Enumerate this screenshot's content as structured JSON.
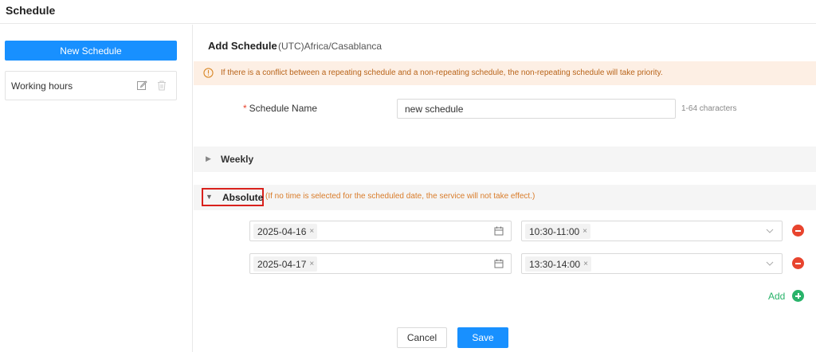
{
  "page": {
    "title": "Schedule"
  },
  "sidebar": {
    "new_button": "New Schedule",
    "schedules": [
      {
        "name": "Working hours",
        "icons": [
          "edit-icon",
          "delete-icon"
        ]
      }
    ]
  },
  "form": {
    "title": "Add Schedule",
    "timezone": "(UTC)Africa/Casablanca",
    "warning": "If there is a conflict between a repeating schedule and a non-repeating schedule, the non-repeating schedule will take priority.",
    "name_label": "Schedule Name",
    "required_mark": "*",
    "name_value": "new schedule",
    "name_hint": "1-64 characters",
    "weekly_label": "Weekly",
    "absolute_label": "Absolute",
    "absolute_note": "(If no time is selected for the scheduled date, the service will not take effect.)",
    "rows": [
      {
        "date": "2025-04-16",
        "time": "10:30-11:00"
      },
      {
        "date": "2025-04-17",
        "time": "13:30-14:00"
      }
    ],
    "tag_remove": "×",
    "add_label": "Add",
    "cancel": "Cancel",
    "save": "Save"
  },
  "colors": {
    "primary": "#1890ff",
    "warning_bg": "#fdefe4",
    "warning_text": "#b8641a",
    "danger": "#e8442e",
    "success": "#29b36a",
    "highlight_box": "#d9211c"
  }
}
